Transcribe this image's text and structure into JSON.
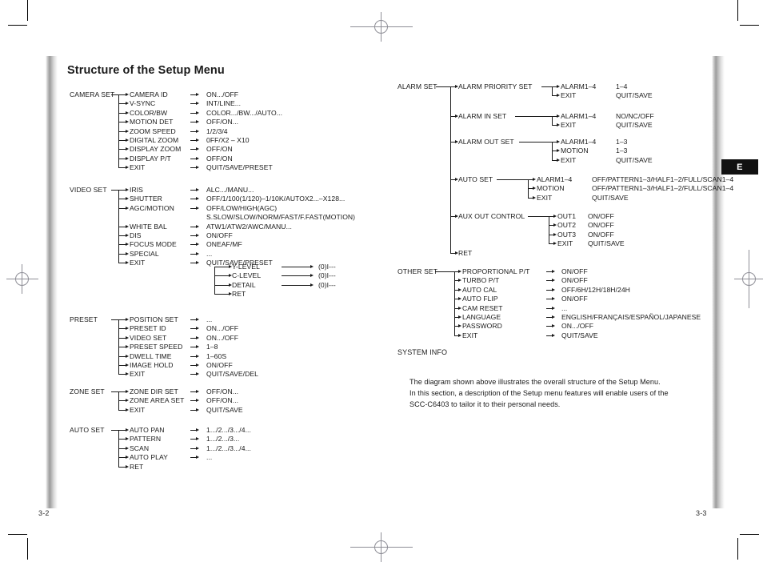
{
  "document": {
    "heading": "Structure of the Setup Menu",
    "thumb_tab": "E",
    "folio_left": "3-2",
    "folio_right": "3-3",
    "system_info_label": "SYSTEM INFO",
    "paragraph_line1": "The diagram shown above illustrates the overall structure of the Setup Menu.",
    "paragraph_line2": "In this section, a description of the Setup menu features will enable users of the",
    "paragraph_line3": "SCC-C6403 to tailor it to their personal needs.",
    "arrow_glyph": "→",
    "colors": {
      "ink": "#1a1a1a",
      "tab_background": "#111111",
      "tab_text": "#ffffff",
      "rule": "#8e8e96"
    }
  },
  "left_page": {
    "groups": [
      {
        "root": "CAMERA SET",
        "rows": [
          {
            "item": "CAMERA ID",
            "value": "ON.../OFF"
          },
          {
            "item": "V-SYNC",
            "value": "INT/LINE..."
          },
          {
            "item": "COLOR/BW",
            "value": "COLOR.../BW.../AUTO..."
          },
          {
            "item": "MOTION DET",
            "value": "OFF/ON..."
          },
          {
            "item": "ZOOM SPEED",
            "value": "1/2/3/4"
          },
          {
            "item": "DIGITAL ZOOM",
            "value": "0FF/X2 – X10"
          },
          {
            "item": "DISPLAY ZOOM",
            "value": "OFF/ON"
          },
          {
            "item": "DISPLAY P/T",
            "value": "OFF/ON"
          },
          {
            "item": "EXIT",
            "value": "QUIT/SAVE/PRESET"
          }
        ]
      },
      {
        "root": "VIDEO SET",
        "rows": [
          {
            "item": "IRIS",
            "value": "ALC.../MANU..."
          },
          {
            "item": "SHUTTER",
            "value": "OFF/1/100(1/120)–1/10K/AUTOX2...–X128..."
          },
          {
            "item": "AGC/MOTION",
            "value": "OFF/LOW/HIGH(AGC)"
          },
          {
            "item": "",
            "value": "S.SLOW/SLOW/NORM/FAST/F.FAST(MOTION)"
          },
          {
            "item": "WHITE BAL",
            "value": "ATW1/ATW2/AWC/MANU..."
          },
          {
            "item": "DIS",
            "value": "ON/OFF"
          },
          {
            "item": "FOCUS MODE",
            "value": "ONEAF/MF"
          },
          {
            "item": "SPECIAL",
            "value": "..."
          },
          {
            "item": "EXIT",
            "value": "QUIT/SAVE/PRESET"
          }
        ],
        "sub": [
          {
            "item": "Y-LEVEL",
            "value": "(0)I---"
          },
          {
            "item": "C-LEVEL",
            "value": "(0)I---"
          },
          {
            "item": "DETAIL",
            "value": "(0)I---"
          },
          {
            "item": "RET",
            "value": ""
          }
        ]
      },
      {
        "root": "PRESET",
        "rows": [
          {
            "item": "POSITION SET",
            "value": "..."
          },
          {
            "item": "PRESET ID",
            "value": "ON.../OFF"
          },
          {
            "item": "VIDEO SET",
            "value": "ON.../OFF"
          },
          {
            "item": "PRESET SPEED",
            "value": "1–8"
          },
          {
            "item": "DWELL TIME",
            "value": "1–60S"
          },
          {
            "item": "IMAGE HOLD",
            "value": "ON/OFF"
          },
          {
            "item": "EXIT",
            "value": "QUIT/SAVE/DEL"
          }
        ]
      },
      {
        "root": "ZONE SET",
        "rows": [
          {
            "item": "ZONE DIR SET",
            "value": "OFF/ON..."
          },
          {
            "item": "ZONE AREA SET",
            "value": "OFF/ON..."
          },
          {
            "item": "EXIT",
            "value": "QUIT/SAVE"
          }
        ]
      },
      {
        "root": "AUTO SET",
        "rows": [
          {
            "item": "AUTO PAN",
            "value": "1.../2.../3.../4..."
          },
          {
            "item": "PATTERN",
            "value": "1.../2.../3..."
          },
          {
            "item": "SCAN",
            "value": "1.../2.../3.../4..."
          },
          {
            "item": "AUTO PLAY",
            "value": "..."
          },
          {
            "item": "RET",
            "value": ""
          }
        ]
      }
    ]
  },
  "right_page": {
    "alarm_set": {
      "root": "ALARM SET",
      "branches": [
        {
          "name": "ALARM PRIORITY SET",
          "rows": [
            {
              "item": "ALARM1–4",
              "value": "1–4"
            },
            {
              "item": "EXIT",
              "value": "QUIT/SAVE"
            }
          ]
        },
        {
          "name": "ALARM IN SET",
          "rows": [
            {
              "item": "ALARM1–4",
              "value": "NO/NC/OFF"
            },
            {
              "item": "EXIT",
              "value": "QUIT/SAVE"
            }
          ]
        },
        {
          "name": "ALARM OUT SET",
          "rows": [
            {
              "item": "ALARM1–4",
              "value": "1–3"
            },
            {
              "item": "MOTION",
              "value": "1–3"
            },
            {
              "item": "EXIT",
              "value": "QUIT/SAVE"
            }
          ]
        },
        {
          "name": "AUTO SET",
          "rows": [
            {
              "item": "ALARM1–4",
              "value": "OFF/PATTERN1–3/HALF1–2/FULL/SCAN1–4"
            },
            {
              "item": "MOTION",
              "value": "OFF/PATTERN1–3/HALF1–2/FULL/SCAN1–4"
            },
            {
              "item": "EXIT",
              "value": "QUIT/SAVE"
            }
          ]
        },
        {
          "name": "AUX OUT CONTROL",
          "rows": [
            {
              "item": "OUT1",
              "value": "ON/OFF"
            },
            {
              "item": "OUT2",
              "value": "ON/OFF"
            },
            {
              "item": "OUT3",
              "value": "ON/OFF"
            },
            {
              "item": "EXIT",
              "value": "QUIT/SAVE"
            }
          ]
        },
        {
          "name": "RET",
          "rows": []
        }
      ]
    },
    "other_set": {
      "root": "OTHER SET",
      "rows": [
        {
          "item": "PROPORTIONAL P/T",
          "value": "ON/OFF"
        },
        {
          "item": "TURBO P/T",
          "value": "ON/OFF"
        },
        {
          "item": "AUTO CAL",
          "value": "OFF/6H/12H/18H/24H"
        },
        {
          "item": "AUTO FLIP",
          "value": "ON/OFF"
        },
        {
          "item": "CAM RESET",
          "value": "..."
        },
        {
          "item": "LANGUAGE",
          "value": "ENGLISH/FRANÇAIS/ESPAÑOL/JAPANESE"
        },
        {
          "item": "PASSWORD",
          "value": "ON.../OFF"
        },
        {
          "item": "EXIT",
          "value": "QUIT/SAVE"
        }
      ]
    }
  }
}
